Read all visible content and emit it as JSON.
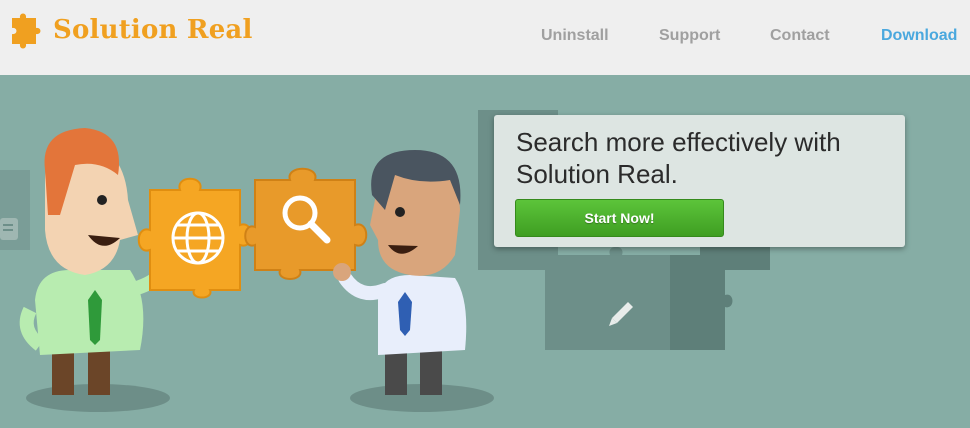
{
  "brand": {
    "name": "Solution Real"
  },
  "nav": {
    "items": [
      {
        "label": "Uninstall"
      },
      {
        "label": "Support"
      },
      {
        "label": "Contact"
      },
      {
        "label": "Download"
      }
    ]
  },
  "promo": {
    "headline": "Search more effectively with Solution Real.",
    "button_label": "Start Now!"
  },
  "colors": {
    "brand_orange": "#f0a020",
    "hero_background": "#86ada5",
    "header_background": "#efefef",
    "nav_gray": "#a0a0a0",
    "nav_active_blue": "#4aa8de",
    "button_green": "#4cb22c"
  },
  "icons": [
    "puzzle-logo-icon",
    "globe-icon",
    "magnifier-icon",
    "pencil-icon",
    "chat-bubble-icon",
    "mail-icon"
  ]
}
